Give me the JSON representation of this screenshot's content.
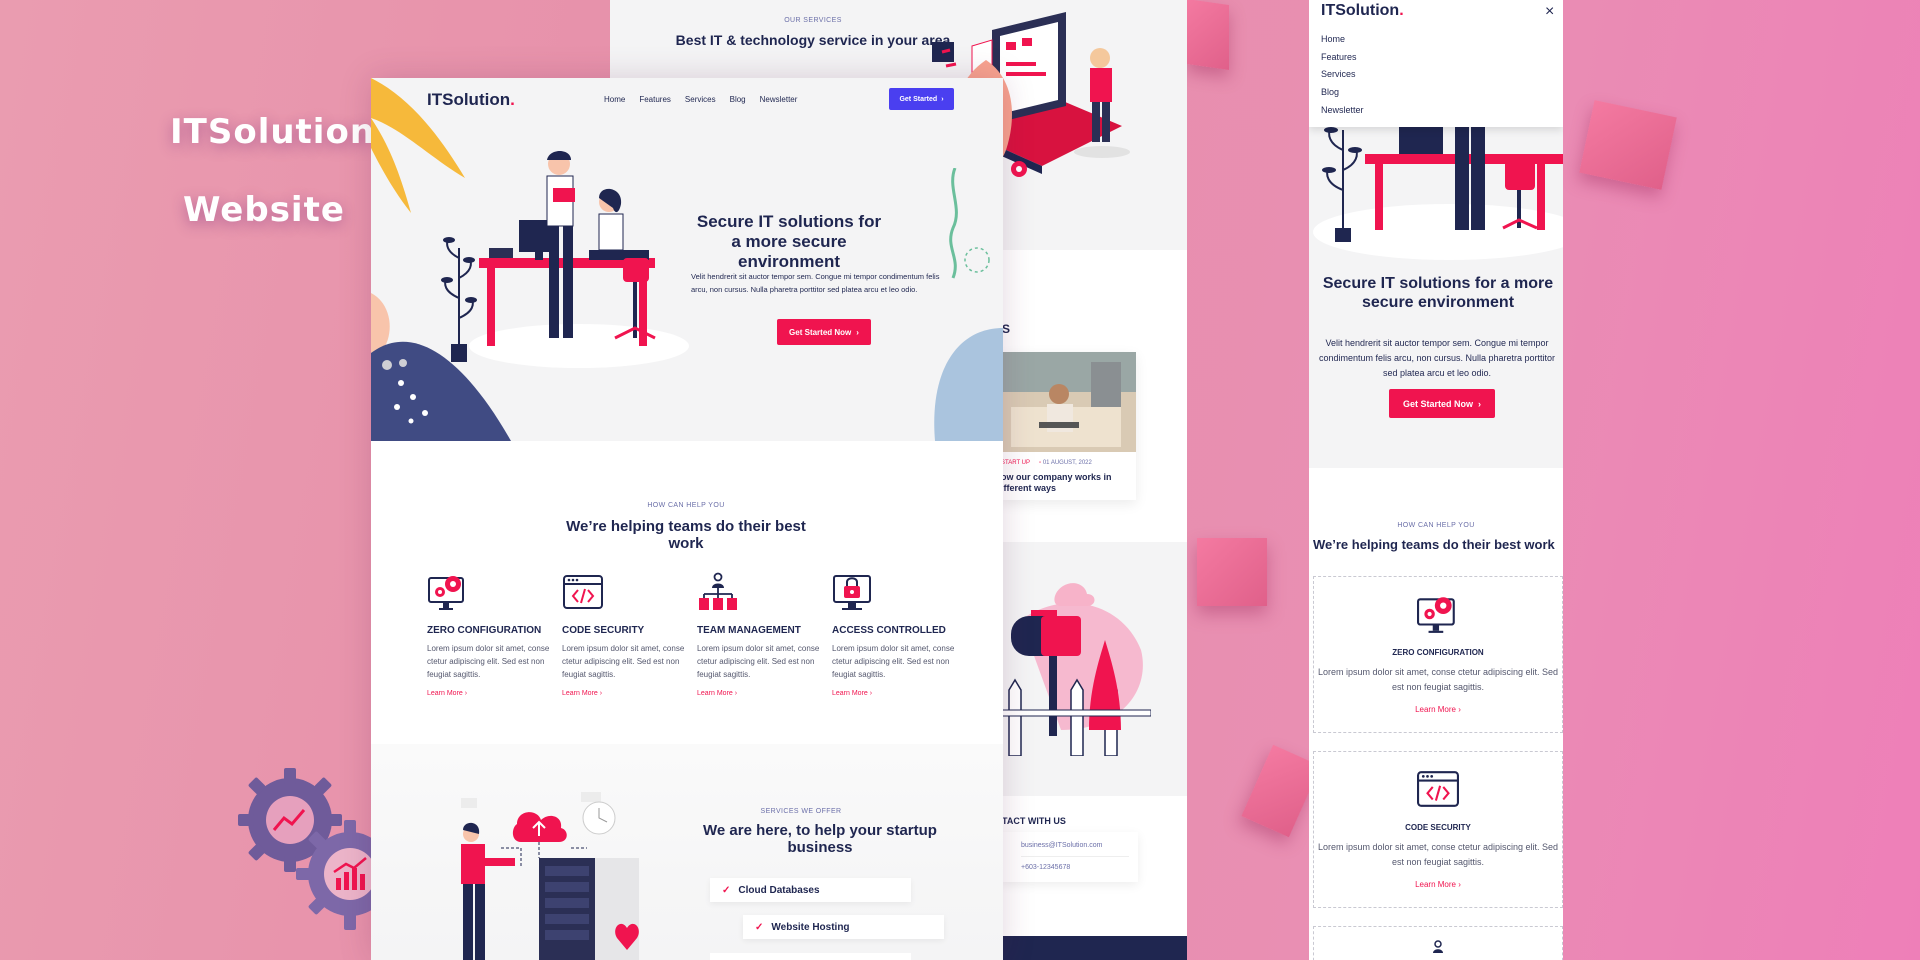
{
  "promo": {
    "line1": "ITSolution",
    "line2": "Website"
  },
  "brand": {
    "name": "ITSolution",
    "dot": "."
  },
  "nav": {
    "items": [
      "Home",
      "Features",
      "Services",
      "Blog",
      "Newsletter"
    ],
    "cta": "Get Started"
  },
  "hero": {
    "title": "Secure IT solutions for a more secure environment",
    "text": "Velit hendrerit sit auctor tempor sem. Congue mi tempor condimentum felis arcu, non cursus. Nulla pharetra porttitor sed platea arcu et leo odio.",
    "cta": "Get Started Now"
  },
  "features_section": {
    "eyebrow": "HOW CAN HELP YOU",
    "title": "We’re helping teams do their best work",
    "items": [
      {
        "title": "ZERO CONFIGURATION",
        "text": "Lorem ipsum dolor sit amet, conse ctetur adipiscing elit. Sed est non feugiat sagittis.",
        "link": "Learn More",
        "icon": "monitor-gear-icon"
      },
      {
        "title": "CODE SECURITY",
        "text": "Lorem ipsum dolor sit amet, conse ctetur adipiscing elit. Sed est non feugiat sagittis.",
        "link": "Learn More",
        "icon": "code-window-icon"
      },
      {
        "title": "TEAM MANAGEMENT",
        "text": "Lorem ipsum dolor sit amet, conse ctetur adipiscing elit. Sed est non feugiat sagittis.",
        "link": "Learn More",
        "icon": "hierarchy-icon"
      },
      {
        "title": "ACCESS CONTROLLED",
        "text": "Lorem ipsum dolor sit amet, conse ctetur adipiscing elit. Sed est non feugiat sagittis.",
        "link": "Learn More",
        "icon": "monitor-lock-icon"
      }
    ]
  },
  "services_offer": {
    "eyebrow": "SERVICES WE OFFER",
    "title": "We are here, to help your startup business",
    "items": [
      "Cloud Databases",
      "Website Hosting"
    ]
  },
  "back_page": {
    "eyebrow": "OUR SERVICES",
    "title": "Best IT & technology service in your area",
    "blog_letter": "S",
    "blog_category": "START UP",
    "blog_date": "01 AUGUST, 2022",
    "blog_title": "ow our company works in ifferent ways",
    "contact_title": "TACT WITH US",
    "contact_email": "business@ITSolution.com",
    "contact_phone": "+603-12345678"
  },
  "mobile": {
    "brand": "ITSolution",
    "menu": [
      "Home",
      "Features",
      "Services",
      "Blog",
      "Newsletter"
    ],
    "close": "×",
    "hero_title": "Secure IT solutions for a more secure environment",
    "hero_text": "Velit hendrerit sit auctor tempor sem. Congue mi tempor condimentum felis arcu, non cursus. Nulla pharetra porttitor sed platea arcu et leo odio.",
    "hero_cta": "Get Started Now",
    "features_eyebrow": "HOW CAN HELP YOU",
    "features_title": "We’re helping teams do their best work",
    "cards": [
      {
        "title": "ZERO CONFIGURATION",
        "text": "Lorem ipsum dolor sit amet, conse ctetur adipiscing elit. Sed est non feugiat sagittis.",
        "link": "Learn More"
      },
      {
        "title": "CODE SECURITY",
        "text": "Lorem ipsum dolor sit amet, conse ctetur adipiscing elit. Sed est non feugiat sagittis.",
        "link": "Learn More"
      }
    ]
  },
  "colors": {
    "navy": "#1f2650",
    "accent_red": "#f0144f",
    "accent_blue": "#4a3ff0",
    "panel_grey": "#f4f4f5"
  }
}
